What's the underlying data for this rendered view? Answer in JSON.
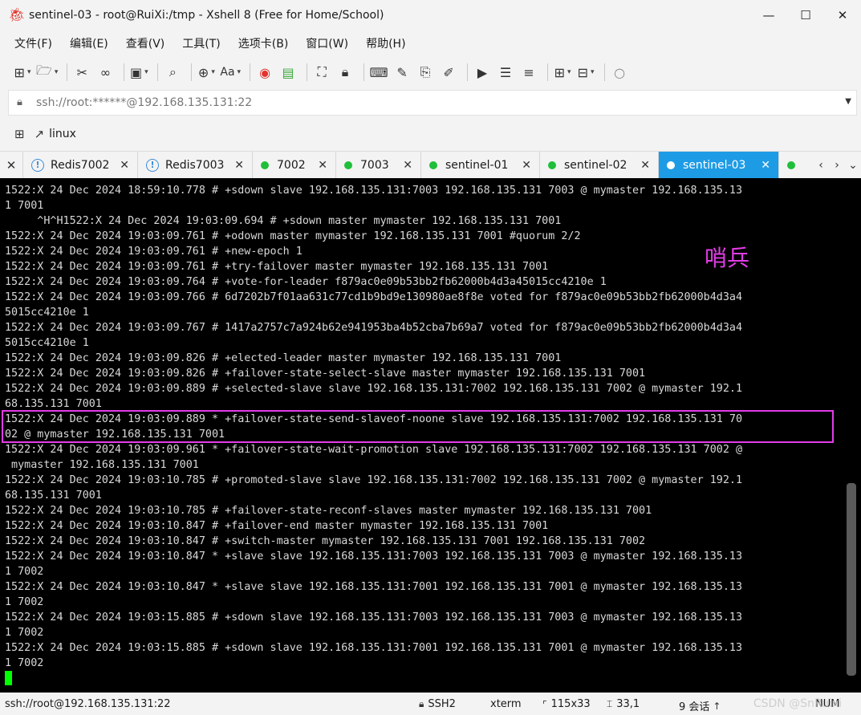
{
  "window": {
    "title": "sentinel-03 - root@RuiXi:/tmp - Xshell 8 (Free for Home/School)",
    "minimize": "—",
    "maximize": "☐",
    "close": "✕"
  },
  "menu": [
    "文件(F)",
    "编辑(E)",
    "查看(V)",
    "工具(T)",
    "选项卡(B)",
    "窗口(W)",
    "帮助(H)"
  ],
  "address": {
    "value": "ssh://root:******@192.168.135.131:22"
  },
  "links": {
    "label": "linux"
  },
  "tabs": [
    {
      "label": "Redis7002",
      "status": "warn"
    },
    {
      "label": "Redis7003",
      "status": "warn"
    },
    {
      "label": "7002",
      "status": "ok"
    },
    {
      "label": "7003",
      "status": "ok"
    },
    {
      "label": "sentinel-01",
      "status": "ok"
    },
    {
      "label": "sentinel-02",
      "status": "ok"
    },
    {
      "label": "sentinel-03",
      "status": "ok",
      "active": true
    }
  ],
  "terminal": {
    "lines": [
      "1522:X 24 Dec 2024 18:59:10.778 # +sdown slave 192.168.135.131:7003 192.168.135.131 7003 @ mymaster 192.168.135.13",
      "1 7001",
      "     ^H^H1522:X 24 Dec 2024 19:03:09.694 # +sdown master mymaster 192.168.135.131 7001",
      "1522:X 24 Dec 2024 19:03:09.761 # +odown master mymaster 192.168.135.131 7001 #quorum 2/2",
      "1522:X 24 Dec 2024 19:03:09.761 # +new-epoch 1",
      "1522:X 24 Dec 2024 19:03:09.761 # +try-failover master mymaster 192.168.135.131 7001",
      "1522:X 24 Dec 2024 19:03:09.764 # +vote-for-leader f879ac0e09b53bb2fb62000b4d3a45015cc4210e 1",
      "1522:X 24 Dec 2024 19:03:09.766 # 6d7202b7f01aa631c77cd1b9bd9e130980ae8f8e voted for f879ac0e09b53bb2fb62000b4d3a4",
      "5015cc4210e 1",
      "1522:X 24 Dec 2024 19:03:09.767 # 1417a2757c7a924b62e941953ba4b52cba7b69a7 voted for f879ac0e09b53bb2fb62000b4d3a4",
      "5015cc4210e 1",
      "1522:X 24 Dec 2024 19:03:09.826 # +elected-leader master mymaster 192.168.135.131 7001",
      "1522:X 24 Dec 2024 19:03:09.826 # +failover-state-select-slave master mymaster 192.168.135.131 7001",
      "1522:X 24 Dec 2024 19:03:09.889 # +selected-slave slave 192.168.135.131:7002 192.168.135.131 7002 @ mymaster 192.1",
      "68.135.131 7001",
      "1522:X 24 Dec 2024 19:03:09.889 * +failover-state-send-slaveof-noone slave 192.168.135.131:7002 192.168.135.131 70",
      "02 @ mymaster 192.168.135.131 7001",
      "1522:X 24 Dec 2024 19:03:09.961 * +failover-state-wait-promotion slave 192.168.135.131:7002 192.168.135.131 7002 @",
      " mymaster 192.168.135.131 7001",
      "1522:X 24 Dec 2024 19:03:10.785 # +promoted-slave slave 192.168.135.131:7002 192.168.135.131 7002 @ mymaster 192.1",
      "68.135.131 7001",
      "1522:X 24 Dec 2024 19:03:10.785 # +failover-state-reconf-slaves master mymaster 192.168.135.131 7001",
      "1522:X 24 Dec 2024 19:03:10.847 # +failover-end master mymaster 192.168.135.131 7001",
      "1522:X 24 Dec 2024 19:03:10.847 # +switch-master mymaster 192.168.135.131 7001 192.168.135.131 7002",
      "1522:X 24 Dec 2024 19:03:10.847 * +slave slave 192.168.135.131:7003 192.168.135.131 7003 @ mymaster 192.168.135.13",
      "1 7002",
      "1522:X 24 Dec 2024 19:03:10.847 * +slave slave 192.168.135.131:7001 192.168.135.131 7001 @ mymaster 192.168.135.13",
      "1 7002",
      "1522:X 24 Dec 2024 19:03:15.885 # +sdown slave 192.168.135.131:7003 192.168.135.131 7003 @ mymaster 192.168.135.13",
      "1 7002",
      "1522:X 24 Dec 2024 19:03:15.885 # +sdown slave 192.168.135.131:7001 192.168.135.131 7001 @ mymaster 192.168.135.13",
      "1 7002"
    ],
    "annotation": "哨兵",
    "colors": {
      "highlight": "#e23ce6",
      "cursor": "#00ff00",
      "text": "#d8d8d8"
    }
  },
  "statusbar": {
    "session": "ssh://root@192.168.135.131:22",
    "protocol": "SSH2",
    "term": "xterm",
    "size": "115x33",
    "cursor_pos": "33,1",
    "sessions": "9 会话",
    "num": "NUM",
    "watermark": "CSDN @SnRuixi"
  },
  "colors": {
    "accent": "#1e9be5",
    "ok": "#1fbf3a"
  }
}
